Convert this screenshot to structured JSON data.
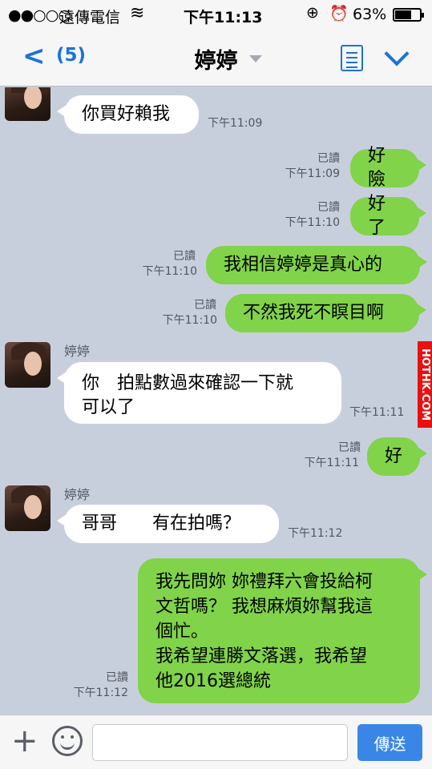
{
  "status_bar": {
    "signal": "●●○○○",
    "carrier": "遠傳電信",
    "time": "下午11:13",
    "battery_percent": "63%",
    "battery_level": 0.63
  },
  "header": {
    "back_count": "(5)",
    "title": "婷婷"
  },
  "messages": [
    {
      "text": "你買好賴我",
      "time": "下午11:09"
    },
    {
      "read": "已讀",
      "time": "下午11:09",
      "text": "好險"
    },
    {
      "read": "已讀",
      "time": "下午11:10",
      "text": "好了"
    },
    {
      "read": "已讀",
      "time": "下午11:10",
      "text": "我相信婷婷是真心的"
    },
    {
      "read": "已讀",
      "time": "下午11:10",
      "text": "不然我死不瞑目啊"
    },
    {
      "sender": "婷婷",
      "line1": "你　拍點數過來確認一下就",
      "line2": "可以了",
      "time": "下午11:11"
    },
    {
      "read": "已讀",
      "time": "下午11:11",
      "text": "好"
    },
    {
      "sender": "婷婷",
      "text": "哥哥　　有在拍嗎？",
      "time": "下午11:12"
    },
    {
      "read": "已讀",
      "time": "下午11:12",
      "line1": "我先問妳 妳禮拜六會投給柯",
      "line2": "文哲嗎？ 我想麻煩妳幫我這",
      "line3": "個忙。",
      "line4": "我希望連勝文落選，我希望",
      "line5": "他2016選總統"
    }
  ],
  "watermark": "HOTHK.COM",
  "input": {
    "placeholder": "",
    "send_label": "傳送"
  },
  "colors": {
    "accent": "#1a73d8",
    "outgoing_bubble": "#81d34a",
    "incoming_bubble": "#ffffff",
    "chat_background": "#c8cfdc",
    "send_button": "#3a86e6"
  }
}
